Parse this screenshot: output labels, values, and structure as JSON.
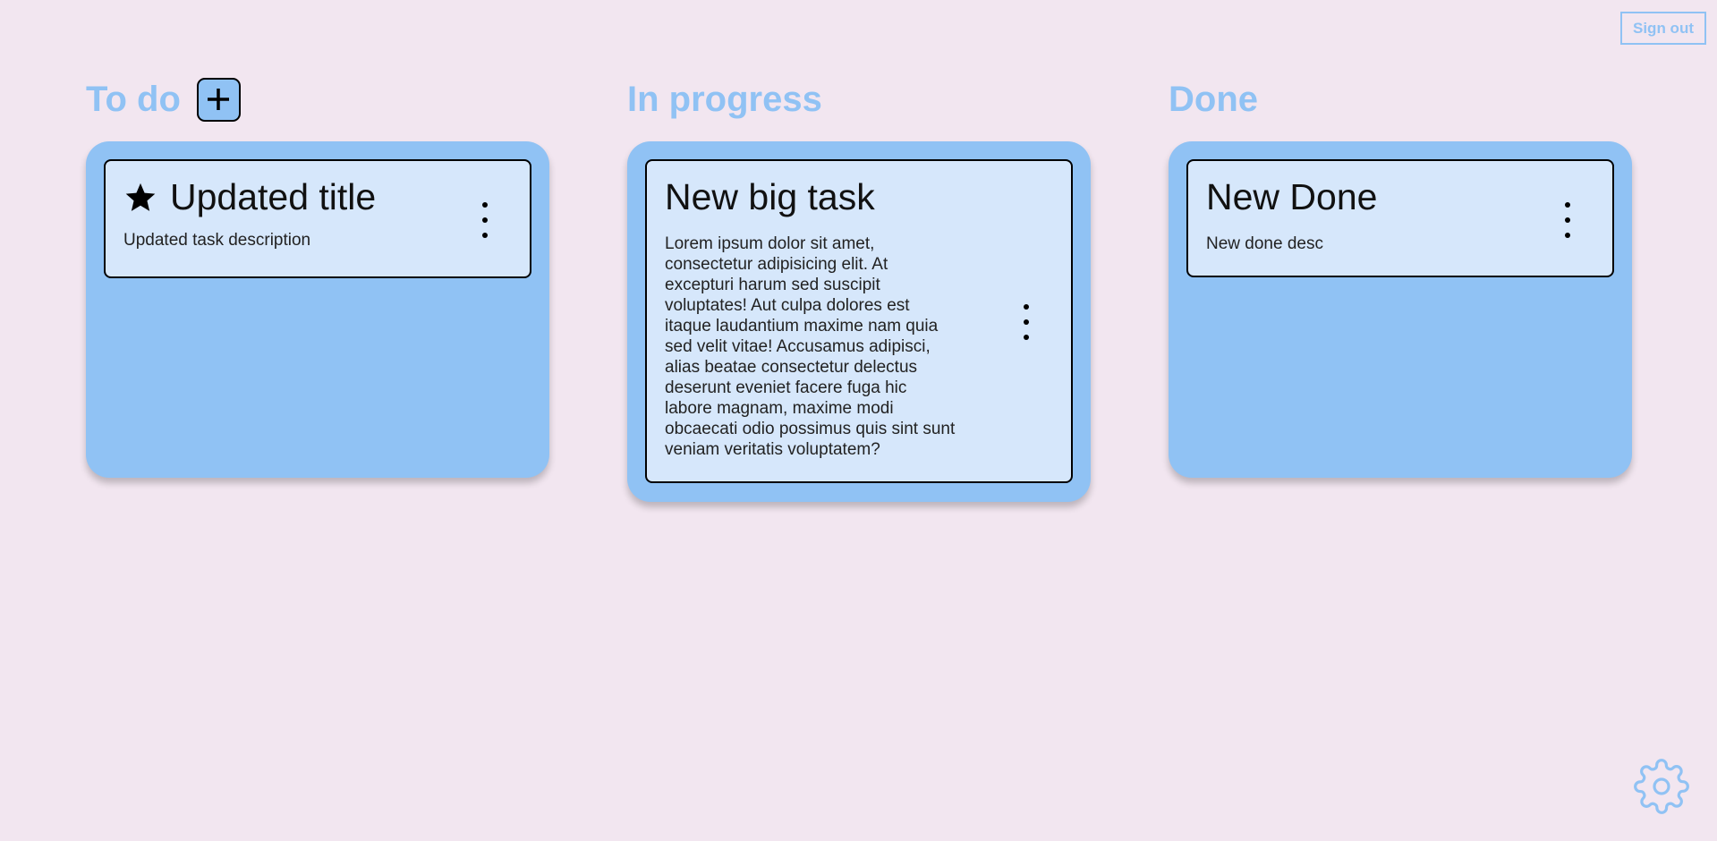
{
  "header": {
    "sign_out_label": "Sign out"
  },
  "columns": [
    {
      "title": "To do",
      "has_add_button": true,
      "cards": [
        {
          "title": "Updated title",
          "description": "Updated task description",
          "starred": true
        }
      ]
    },
    {
      "title": "In progress",
      "cards": [
        {
          "title": "New big task",
          "description": "Lorem ipsum dolor sit amet, consectetur adipisicing elit. At excepturi harum sed suscipit voluptates! Aut culpa dolores est itaque laudantium maxime nam quia sed velit vitae! Accusamus adipisci, alias beatae consectetur delectus deserunt eveniet facere fuga hic labore magnam, maxime modi obcaecati odio possimus quis sint sunt veniam veritatis voluptatem?",
          "starred": false
        }
      ]
    },
    {
      "title": "Done",
      "cards": [
        {
          "title": "New Done",
          "description": "New done desc",
          "starred": false
        }
      ]
    }
  ],
  "icons": {
    "add": "plus-icon",
    "star": "star-icon",
    "menu": "kebab-menu-icon",
    "settings": "gear-icon"
  },
  "colors": {
    "background": "#f2e6f0",
    "accent": "#90c2f4",
    "card": "#d6e7fb"
  }
}
